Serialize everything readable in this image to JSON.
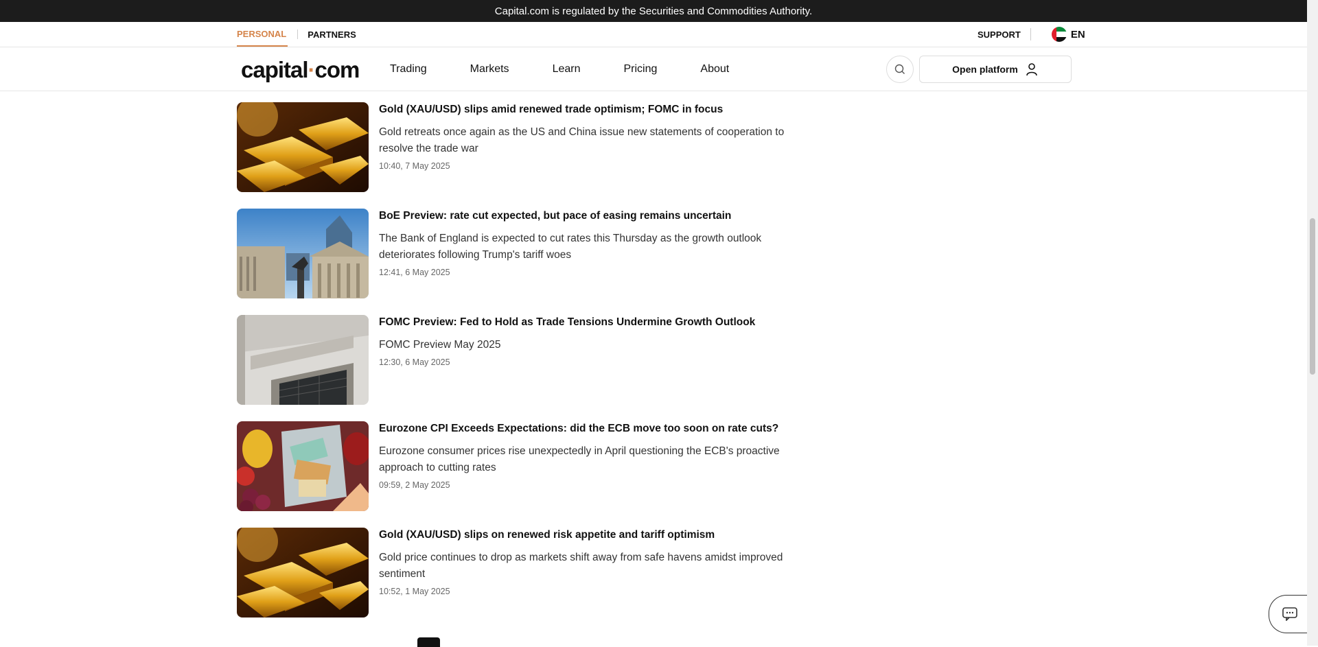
{
  "topbar": {
    "text": "Capital.com is regulated by the Securities and Commodities Authority."
  },
  "subnav": {
    "personal": "PERSONAL",
    "partners": "PARTNERS",
    "support": "SUPPORT",
    "language": "EN"
  },
  "header": {
    "logo_left": "capital",
    "logo_dot": "·",
    "logo_right": "com",
    "nav": [
      "Trading",
      "Markets",
      "Learn",
      "Pricing",
      "About"
    ],
    "open_platform": "Open platform"
  },
  "articles": [
    {
      "title": "Gold (XAU/USD) slips amid renewed trade optimism; FOMC in focus",
      "description": "Gold retreats once again as the US and China issue new statements of cooperation to resolve the trade war",
      "time": "10:40, 7 May 2025",
      "image": "gold-bars"
    },
    {
      "title": "BoE Preview: rate cut expected, but pace of easing remains uncertain",
      "description": "The Bank of England is expected to cut rates this Thursday as the growth outlook deteriorates following Trump's tariff woes",
      "time": "12:41, 6 May 2025",
      "image": "bank-of-england"
    },
    {
      "title": "FOMC Preview: Fed to Hold as Trade Tensions Undermine Growth Outlook",
      "description": "FOMC Preview May 2025",
      "time": "12:30, 6 May 2025",
      "image": "federal-reserve"
    },
    {
      "title": "Eurozone CPI Exceeds Expectations: did the ECB move too soon on rate cuts?",
      "description": "Eurozone consumer prices rise unexpectedly in April questioning the ECB's proactive approach to cutting rates",
      "time": "09:59, 2 May 2025",
      "image": "grocery-basket"
    },
    {
      "title": "Gold (XAU/USD) slips on renewed risk appetite and tariff optimism",
      "description": "Gold price continues to drop as markets shift away from safe havens amidst improved sentiment",
      "time": "10:52, 1 May 2025",
      "image": "gold-bars"
    }
  ],
  "colors": {
    "accent": "#d5844a",
    "topbar": "#1c1c1c"
  }
}
